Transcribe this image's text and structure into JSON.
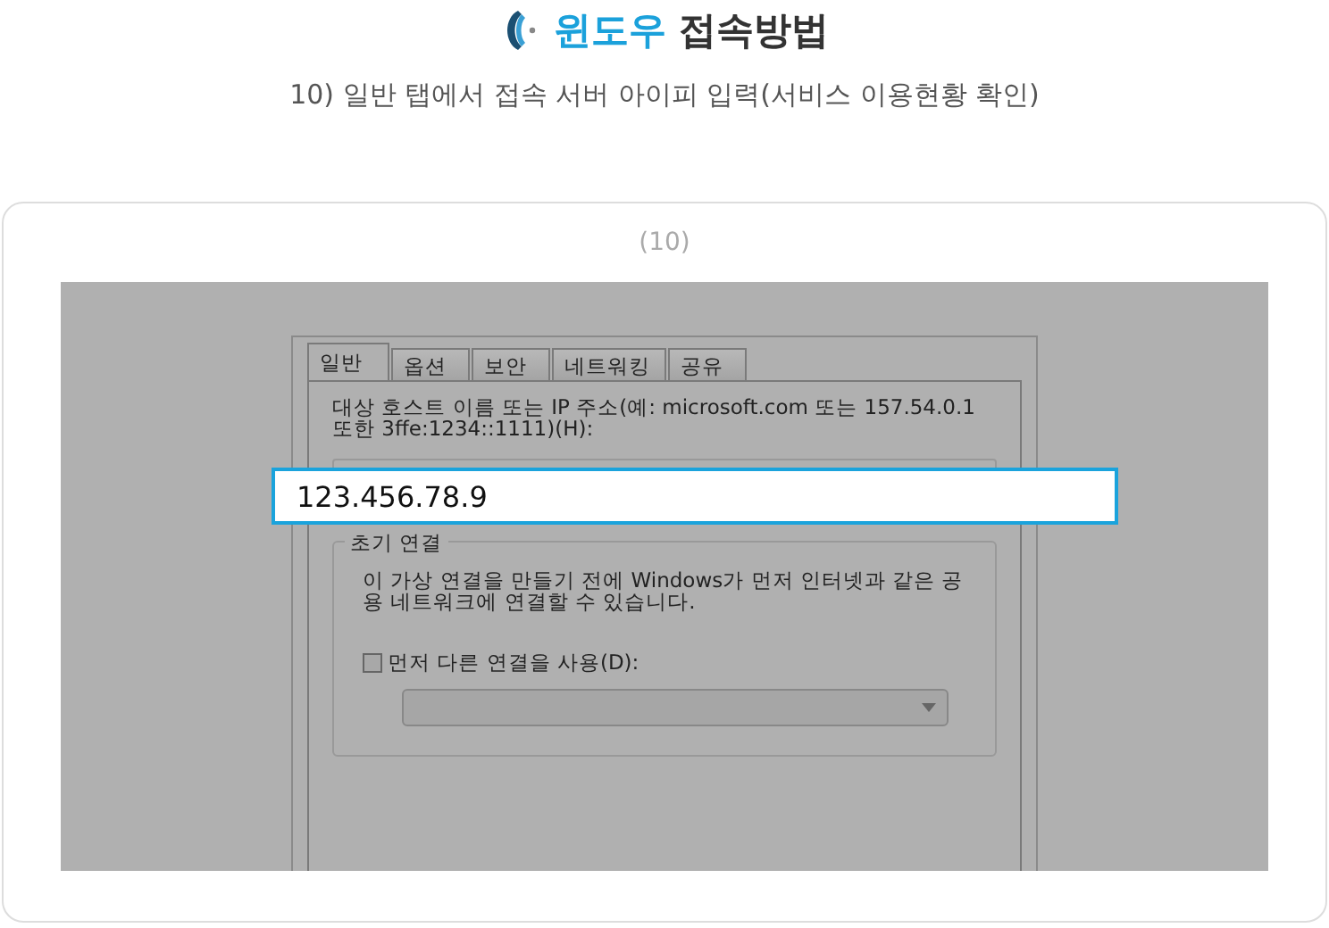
{
  "header": {
    "title_highlight": "윈도우",
    "title_rest": "접속방법",
    "subtitle": "10) 일반 탭에서 접속 서버 아이피 입력(서비스 이용현황 확인)"
  },
  "step": {
    "label": "(10)"
  },
  "dialog": {
    "tabs": [
      {
        "label": "일반",
        "selected": true
      },
      {
        "label": "옵션",
        "selected": false
      },
      {
        "label": "보안",
        "selected": false
      },
      {
        "label": "네트워킹",
        "selected": false
      },
      {
        "label": "공유",
        "selected": false
      }
    ],
    "host_label": "대상 호스트 이름 또는 IP 주소(예: microsoft.com 또는 157.54.0.1 또한 3ffe:1234::1111)(H):",
    "host_value": "123.456.78.9",
    "group_title": "초기 연결",
    "group_text": "이 가상 연결을 만들기 전에 Windows가 먼저 인터넷과 같은 공용 네트워크에 연결할 수 있습니다.",
    "checkbox": {
      "label": "먼저 다른 연결을 사용(D):",
      "checked": false
    }
  }
}
